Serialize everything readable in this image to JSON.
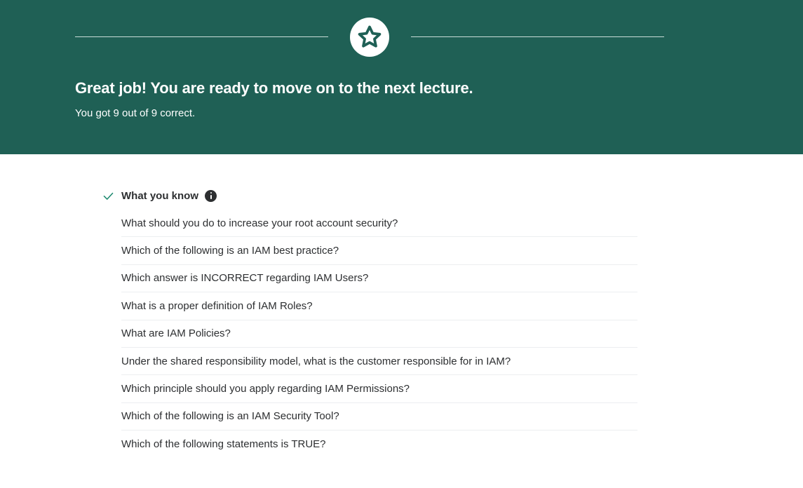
{
  "banner": {
    "icon": "star-icon",
    "headline": "Great job! You are ready to move on to the next lecture.",
    "score_text": "You got 9 out of 9 correct.",
    "background_color": "#1f6055"
  },
  "section": {
    "status_icon": "check-icon",
    "title": "What you know",
    "info_icon": "info-icon",
    "accent_color": "#1f8a70"
  },
  "questions": [
    "What should you do to increase your root account security?",
    "Which of the following is an IAM best practice?",
    "Which answer is INCORRECT regarding IAM Users?",
    "What is a proper definition of IAM Roles?",
    "What are IAM Policies?",
    "Under the shared responsibility model, what is the customer responsible for in IAM?",
    "Which principle should you apply regarding IAM Permissions?",
    "Which of the following is an IAM Security Tool?",
    "Which of the following statements is TRUE?"
  ]
}
